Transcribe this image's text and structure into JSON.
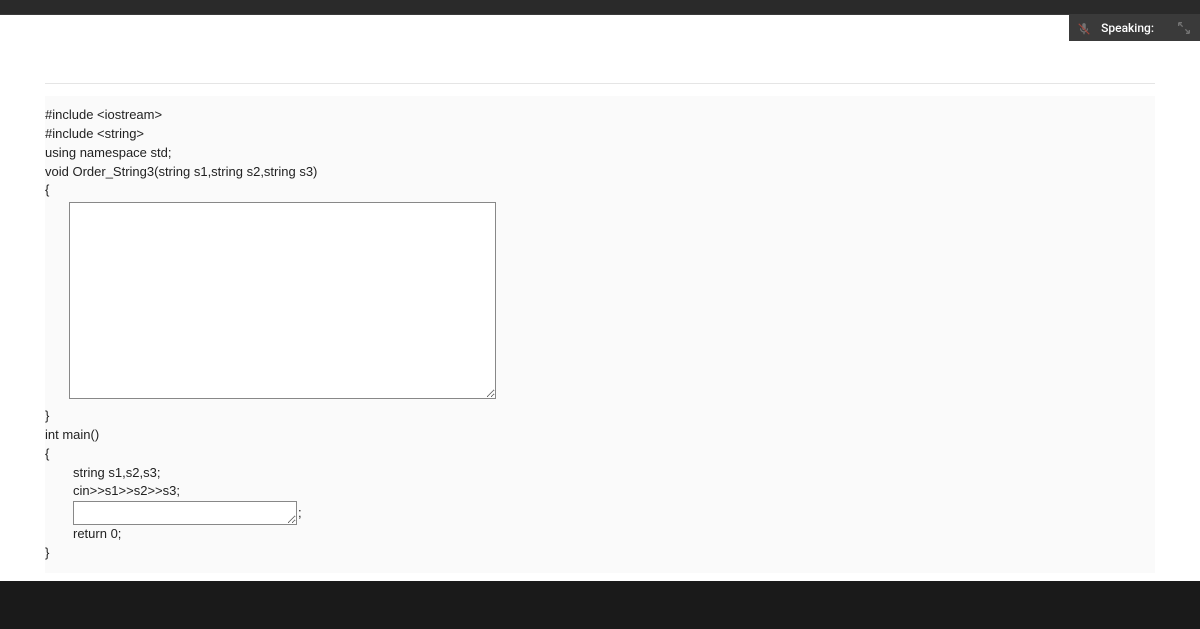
{
  "toolbar": {
    "speaking_label": "Speaking:"
  },
  "code": {
    "line1": "#include <iostream>",
    "line2": "#include <string>",
    "line3": "using namespace std;",
    "line4": "void Order_String3(string s1,string s2,string s3)",
    "line5": "{",
    "line6": "}",
    "line7": "int main()",
    "line8": "{",
    "line9": "string s1,s2,s3;",
    "line10": "cin>>s1>>s2>>s3;",
    "line11_semicolon": ";",
    "line12": "return 0;",
    "line13": "}"
  },
  "inputs": {
    "body_value": "",
    "call_value": ""
  }
}
